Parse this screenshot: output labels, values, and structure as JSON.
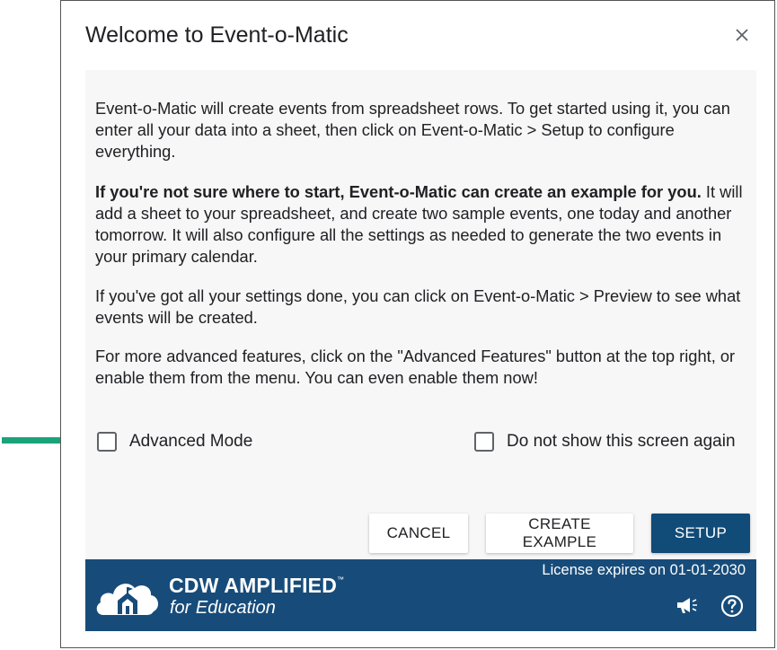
{
  "dialog": {
    "title": "Welcome to Event-o-Matic",
    "close_icon": "close-icon"
  },
  "content": {
    "paragraph1": "Event-o-Matic will create events from spreadsheet rows. To get started using it, you can enter all your data into a sheet, then click on Event-o-Matic > Setup to configure everything.",
    "paragraph2_bold": "If you're not sure where to start, Event-o-Matic can create an example for you.",
    "paragraph2_rest": " It will add a sheet to your spreadsheet, and create two sample events, one today and another tomorrow. It will also configure all the settings as needed to generate the two events in your primary calendar.",
    "paragraph3": "If you've got all your settings done, you can click on Event-o-Matic > Preview to see what events will be created.",
    "paragraph4": "For more advanced features, click on the \"Advanced Features\" button at the top right, or enable them from the menu. You can even enable them now!"
  },
  "options": {
    "advanced_mode": {
      "label": "Advanced Mode",
      "checked": false
    },
    "dont_show": {
      "label": "Do not show this screen again",
      "checked": false
    }
  },
  "buttons": {
    "cancel": "CANCEL",
    "create_example": "CREATE EXAMPLE",
    "setup": "SETUP"
  },
  "footer": {
    "brand_name": "CDW AMPLIFIED",
    "brand_tm": "™",
    "brand_sub": "for Education",
    "license": "License expires on 01-01-2030",
    "icons": [
      "megaphone-icon",
      "help-icon"
    ]
  },
  "colors": {
    "primary": "#114b78",
    "footer_bg": "#174c7a",
    "arrow": "#1aa37a",
    "content_bg": "#f7f7f7"
  }
}
